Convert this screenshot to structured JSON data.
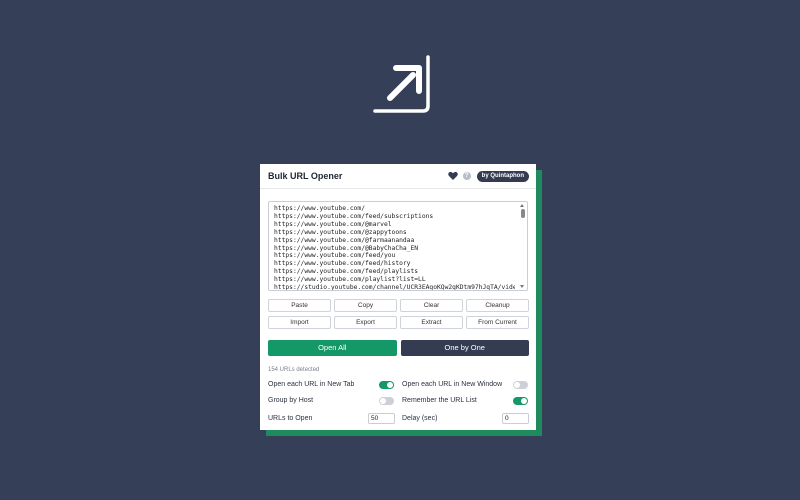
{
  "extension": {
    "title": "Bulk URL Opener",
    "badge": "by Quintaphon",
    "help_glyph": "?",
    "icons": [
      "arrow-up-right-icon",
      "heart-icon",
      "help-icon"
    ]
  },
  "url_box": {
    "urls": [
      "https://www.youtube.com/",
      "https://www.youtube.com/feed/subscriptions",
      "https://www.youtube.com/@marvel",
      "https://www.youtube.com/@zappytoons",
      "https://www.youtube.com/@farmaanandaa",
      "https://www.youtube.com/@BabyChaCha_EN",
      "https://www.youtube.com/feed/you",
      "https://www.youtube.com/feed/history",
      "https://www.youtube.com/feed/playlists",
      "https://www.youtube.com/playlist?list=LL",
      "https://studio.youtube.com/channel/UCR3EAgoKQw2gKDtm97hJqTA/videos"
    ]
  },
  "actions": [
    "Paste",
    "Copy",
    "Clear",
    "Cleanup",
    "Import",
    "Export",
    "Extract",
    "From Current"
  ],
  "open_all_label": "Open All",
  "one_by_one_label": "One by One",
  "status": "154 URLs detected",
  "options": {
    "new_tab": {
      "label": "Open each URL in New Tab",
      "checked": true
    },
    "new_window": {
      "label": "Open each URL in New Window",
      "checked": false
    },
    "group_by_host": {
      "label": "Group by Host",
      "checked": false
    },
    "remember": {
      "label": "Remember the URL List",
      "checked": true
    },
    "urls_to_open": {
      "label": "URLs to Open",
      "value": "50"
    },
    "delay": {
      "label": "Delay (sec)",
      "value": "0"
    }
  },
  "colors": {
    "background": "#353f57",
    "accent": "#159868",
    "dark": "#343c52",
    "card": "#ffffff"
  }
}
